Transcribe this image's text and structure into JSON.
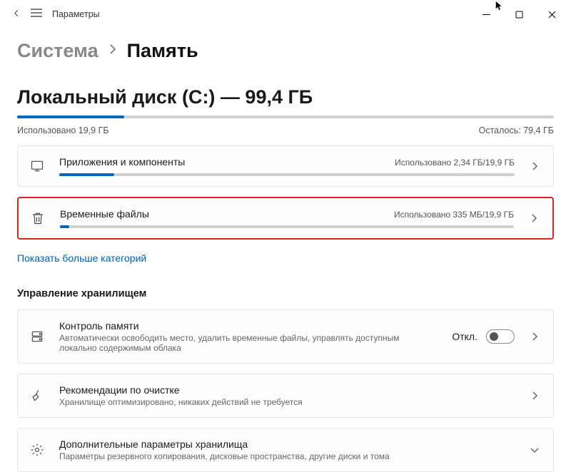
{
  "titlebar": {
    "app_title": "Параметры"
  },
  "breadcrumb": {
    "parent": "Система",
    "current": "Память"
  },
  "disk": {
    "title": "Локальный диск (C:) — 99,4 ГБ",
    "used_label": "Использовано 19,9 ГБ",
    "remaining_label": "Осталось: 79,4 ГБ",
    "used_percent": 20
  },
  "categories": {
    "apps": {
      "label": "Приложения и компоненты",
      "stat": "Использовано 2,34 ГБ/19,9 ГБ",
      "percent": 12
    },
    "temp": {
      "label": "Временные файлы",
      "stat": "Использовано 335 МБ/19,9 ГБ",
      "percent": 2
    }
  },
  "show_more": "Показать больше категорий",
  "section_storage_mgmt": "Управление хранилищем",
  "storage_sense": {
    "title": "Контроль памяти",
    "desc": "Автоматически освободить место, удалить временные файлы, управлять доступным локально содержимым облака",
    "toggle_label": "Откл."
  },
  "cleanup": {
    "title": "Рекомендации по очистке",
    "desc": "Хранилище оптимизировано, никаких действий не требуется"
  },
  "advanced": {
    "title": "Дополнительные параметры хранилища",
    "desc": "Параметры резервного копирования, дисковые пространства, другие диски и тома"
  }
}
